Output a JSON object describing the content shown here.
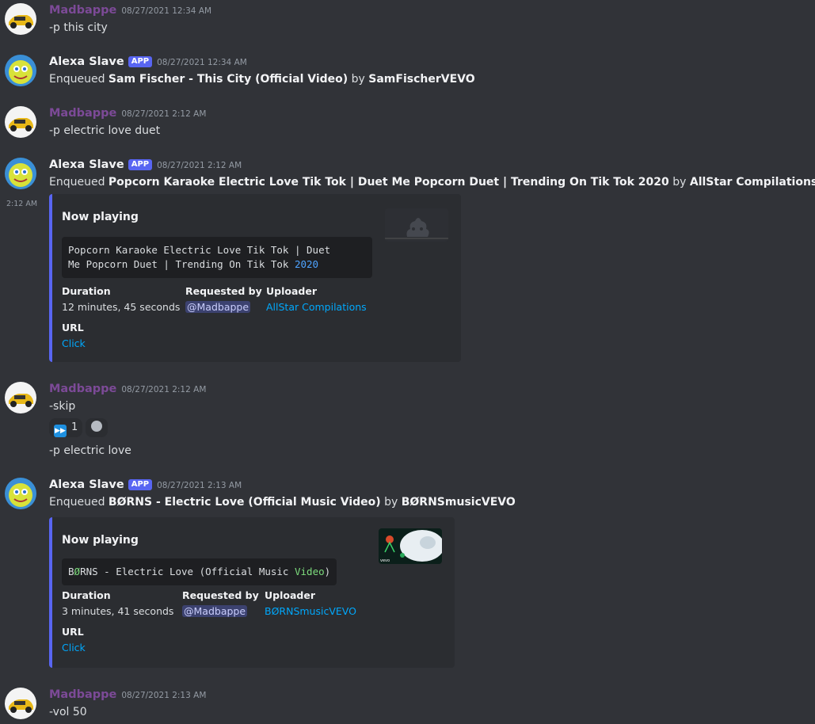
{
  "users": {
    "madbappe": "Madbappe",
    "bot": "Alexa Slave",
    "bot_badge": "APP"
  },
  "messages": [
    {
      "author": "Madbappe",
      "timestamp": "08/27/2021 12:34 AM",
      "text": "-p this city"
    },
    {
      "author": "Alexa Slave",
      "badge": "APP",
      "timestamp": "08/27/2021 12:34 AM",
      "prefix": "Enqueued ",
      "title": "Sam Fischer - This City (Official Video)",
      "by": " by ",
      "uploader": "SamFischerVEVO"
    },
    {
      "author": "Madbappe",
      "timestamp": "08/27/2021 2:12 AM",
      "text": "-p electric love duet"
    },
    {
      "author": "Alexa Slave",
      "badge": "APP",
      "timestamp": "08/27/2021 2:12 AM",
      "prefix": "Enqueued ",
      "title": "Popcorn Karaoke Electric Love Tik Tok | Duet Me Popcorn Duet | Trending On Tik Tok 2020",
      "by": " by ",
      "uploader": "AllStar Compilations",
      "side_timestamp": "2:12 AM",
      "embed": {
        "title": "Now playing",
        "code_line1": "Popcorn Karaoke Electric Love Tik Tok | Duet",
        "code_line2_a": "Me Popcorn Duet | Trending On Tik Tok ",
        "code_line2_b": "2020",
        "fields": {
          "duration_label": "Duration",
          "duration": "12 minutes, 45 seconds",
          "requested_label": "Requested by",
          "requested": "@Madbappe",
          "uploader_label": "Uploader",
          "uploader": "AllStar Compilations",
          "url_label": "URL",
          "url": "Click"
        }
      }
    },
    {
      "author": "Madbappe",
      "timestamp": "08/27/2021 2:12 AM",
      "text": "-skip",
      "reaction": {
        "emoji": "next-track-emoji",
        "count": "1"
      },
      "followup": "-p electric love"
    },
    {
      "author": "Alexa Slave",
      "badge": "APP",
      "timestamp": "08/27/2021 2:13 AM",
      "prefix": "Enqueued ",
      "title": "BØRNS - Electric Love (Official Music Video)",
      "by": " by ",
      "uploader": "BØRNSmusicVEVO",
      "embed": {
        "title": "Now playing",
        "code_a": "B",
        "code_b": "Ø",
        "code_c": "RNS - Electric Love (Official Music ",
        "code_d": "Video",
        "code_e": ")",
        "thumb_label": "vevo",
        "fields": {
          "duration_label": "Duration",
          "duration": "3 minutes, 41 seconds",
          "requested_label": "Requested by",
          "requested": "@Madbappe",
          "uploader_label": "Uploader",
          "uploader": "BØRNSmusicVEVO",
          "url_label": "URL",
          "url": "Click"
        }
      }
    },
    {
      "author": "Madbappe",
      "timestamp": "08/27/2021 2:13 AM",
      "text": "-vol 50"
    }
  ],
  "colors": {
    "background": "#313338",
    "embed_bg": "#2b2d31",
    "embed_accent": "#5865f2",
    "user_name": "#7c4a97",
    "link": "#00a8fc"
  }
}
